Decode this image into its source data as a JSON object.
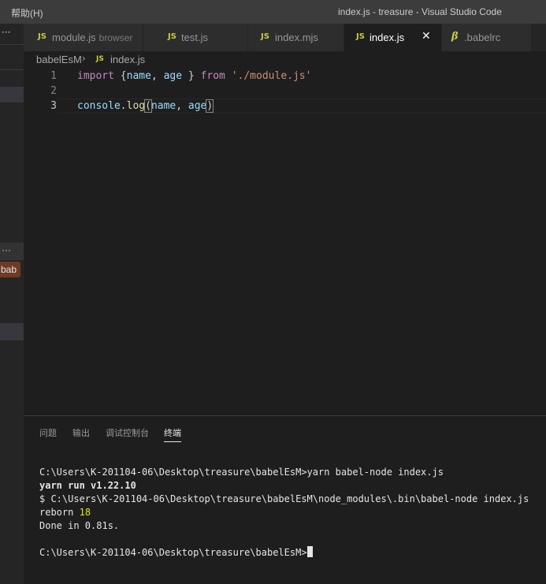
{
  "titlebar": {
    "menu_help": "帮助(H)",
    "window_title": "index.js - treasure - Visual Studio Code"
  },
  "sidebar": {
    "badge_text": "bab"
  },
  "tabs": [
    {
      "label": "module.js",
      "description": "browser",
      "icon": "JS",
      "active": false
    },
    {
      "label": "test.js",
      "icon": "JS",
      "active": false
    },
    {
      "label": "index.mjs",
      "icon": "JS",
      "active": false
    },
    {
      "label": "index.js",
      "icon": "JS",
      "active": true
    },
    {
      "label": ".babelrc",
      "icon": "babel-icon",
      "active": false
    }
  ],
  "tab_icon_text": "JS",
  "babel_icon_glyph": "β",
  "close_glyph": "✕",
  "breadcrumb": {
    "folder": "babelEsM",
    "separator": "›",
    "file_icon": "JS",
    "file": "index.js"
  },
  "editor": {
    "line_numbers": [
      "1",
      "2",
      "3"
    ],
    "lines": [
      "import {name, age } from './module.js'",
      "",
      "console.log(name, age)"
    ],
    "tokens": {
      "kw_import": "import",
      "brace_open": " {",
      "name": "name",
      "comma": ", ",
      "age": "age",
      "brace_close": " } ",
      "kw_from": "from",
      "space": " ",
      "module_path": "'./module.js'",
      "console": "console",
      "dot": ".",
      "log": "log",
      "paren_open": "(",
      "paren_close": ")"
    }
  },
  "panel": {
    "tabs": [
      "问题",
      "输出",
      "调试控制台",
      "终端"
    ],
    "active_tab": "终端"
  },
  "terminal": {
    "lines": [
      "C:\\Users\\K-201104-06\\Desktop\\treasure\\babelEsM>yarn babel-node index.js",
      "yarn run v1.22.10",
      "$ C:\\Users\\K-201104-06\\Desktop\\treasure\\babelEsM\\node_modules\\.bin\\babel-node index.js",
      "reborn",
      "18",
      "Done in 0.81s.",
      "",
      "C:\\Users\\K-201104-06\\Desktop\\treasure\\babelEsM>"
    ]
  },
  "colors": {
    "js_icon": "#cbcb41",
    "keyword": "#c586c0",
    "variable": "#9cdcfe",
    "string": "#ce9178",
    "function": "#dcdcaa",
    "number": "#e5e510",
    "badge_bg": "#6f3a26"
  }
}
